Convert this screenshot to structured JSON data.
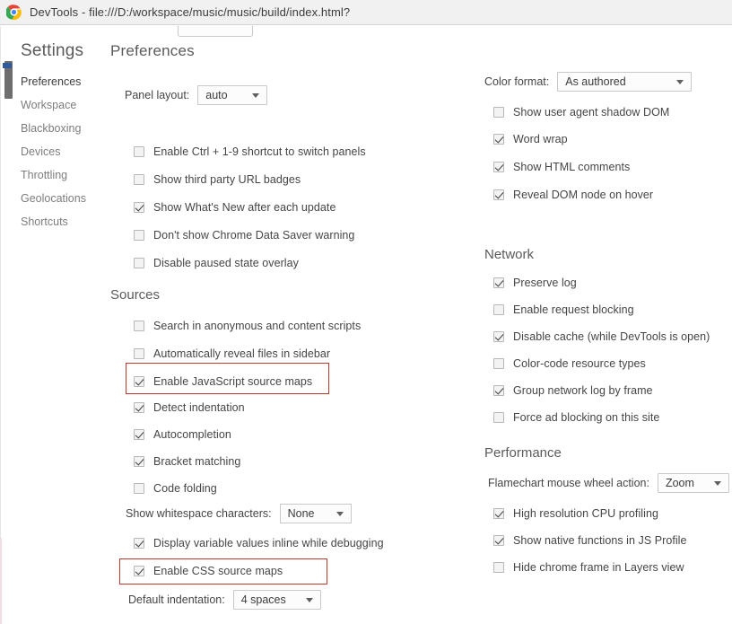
{
  "window": {
    "title": "DevTools - file:///D:/workspace/music/music/build/index.html?",
    "icon": "chrome-logo-icon"
  },
  "sidebar": {
    "title": "Settings",
    "selected": "Preferences",
    "items": [
      {
        "label": "Preferences"
      },
      {
        "label": "Workspace"
      },
      {
        "label": "Blackboxing"
      },
      {
        "label": "Devices"
      },
      {
        "label": "Throttling"
      },
      {
        "label": "Geolocations"
      },
      {
        "label": "Shortcuts"
      }
    ]
  },
  "content": {
    "heading": "Preferences",
    "appearance": {
      "panel_layout": {
        "label": "Panel layout:",
        "value": "auto"
      },
      "checkboxes": [
        {
          "label": "Enable Ctrl + 1-9 shortcut to switch panels",
          "checked": false
        },
        {
          "label": "Show third party URL badges",
          "checked": false
        },
        {
          "label": "Show What's New after each update",
          "checked": true
        },
        {
          "label": "Don't show Chrome Data Saver warning",
          "checked": false
        },
        {
          "label": "Disable paused state overlay",
          "checked": false
        }
      ]
    },
    "sources": {
      "title": "Sources",
      "checkboxes_top": [
        {
          "label": "Search in anonymous and content scripts",
          "checked": false
        },
        {
          "label": "Automatically reveal files in sidebar",
          "checked": false
        },
        {
          "label": "Enable JavaScript source maps",
          "checked": true,
          "highlighted": true
        },
        {
          "label": "Detect indentation",
          "checked": true
        },
        {
          "label": "Autocompletion",
          "checked": true
        },
        {
          "label": "Bracket matching",
          "checked": true
        },
        {
          "label": "Code folding",
          "checked": false
        }
      ],
      "show_whitespace": {
        "label": "Show whitespace characters:",
        "value": "None"
      },
      "checkboxes_bottom": [
        {
          "label": "Display variable values inline while debugging",
          "checked": true
        },
        {
          "label": "Enable CSS source maps",
          "checked": true,
          "highlighted": true
        }
      ],
      "default_indentation": {
        "label": "Default indentation:",
        "value": "4 spaces"
      }
    },
    "elements": {
      "color_format": {
        "label": "Color format:",
        "value": "As authored"
      },
      "checkboxes": [
        {
          "label": "Show user agent shadow DOM",
          "checked": false
        },
        {
          "label": "Word wrap",
          "checked": true
        },
        {
          "label": "Show HTML comments",
          "checked": true
        },
        {
          "label": "Reveal DOM node on hover",
          "checked": true
        }
      ]
    },
    "network": {
      "title": "Network",
      "checkboxes": [
        {
          "label": "Preserve log",
          "checked": true
        },
        {
          "label": "Enable request blocking",
          "checked": false
        },
        {
          "label": "Disable cache (while DevTools is open)",
          "checked": true
        },
        {
          "label": "Color-code resource types",
          "checked": false
        },
        {
          "label": "Group network log by frame",
          "checked": true
        },
        {
          "label": "Force ad blocking on this site",
          "checked": false
        }
      ]
    },
    "performance": {
      "title": "Performance",
      "flamechart": {
        "label": "Flamechart mouse wheel action:",
        "value": "Zoom"
      },
      "checkboxes": [
        {
          "label": "High resolution CPU profiling",
          "checked": true
        },
        {
          "label": "Show native functions in JS Profile",
          "checked": true
        },
        {
          "label": "Hide chrome frame in Layers view",
          "checked": false
        }
      ]
    }
  },
  "colors": {
    "highlight": "#c0392f",
    "titlebar_bg": "#f1f1f1",
    "scroll_tick": "#2f5b9e"
  }
}
